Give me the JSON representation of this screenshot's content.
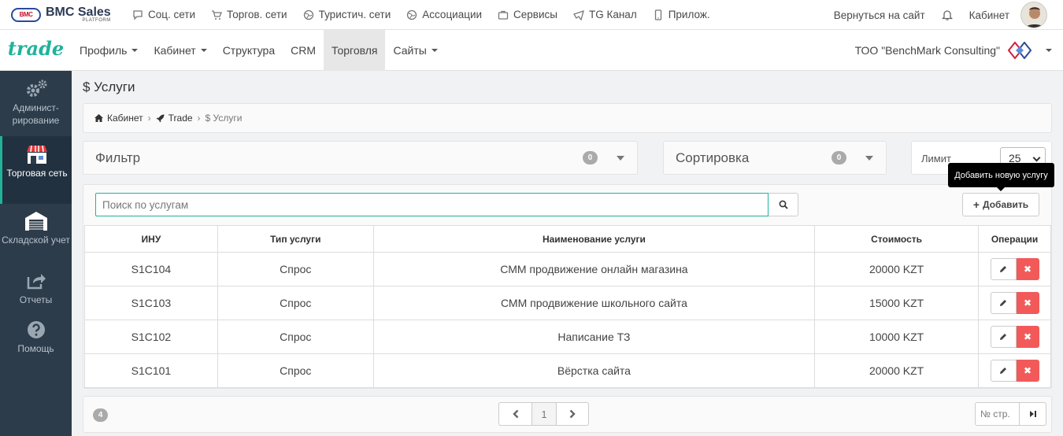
{
  "topbar": {
    "logo_badge": "BMC",
    "logo_title": "BMC Sales",
    "logo_sub": "PLATFORM",
    "links": [
      {
        "label": "Соц. сети",
        "icon": "chat-icon"
      },
      {
        "label": "Торгов. сети",
        "icon": "cart-icon"
      },
      {
        "label": "Туристич. сети",
        "icon": "globe-icon"
      },
      {
        "label": "Ассоциации",
        "icon": "globe-icon"
      },
      {
        "label": "Сервисы",
        "icon": "briefcase-icon"
      },
      {
        "label": "TG Канал",
        "icon": "telegram-icon"
      },
      {
        "label": "Прилож.",
        "icon": "mobile-icon"
      }
    ],
    "back_to_site": "Вернуться на сайт",
    "cabinet": "Кабинет"
  },
  "navbar": {
    "brand": "trade",
    "items": [
      {
        "label": "Профиль",
        "dropdown": true
      },
      {
        "label": "Кабинет",
        "dropdown": true
      },
      {
        "label": "Структура",
        "dropdown": false
      },
      {
        "label": "CRM",
        "dropdown": false
      },
      {
        "label": "Торговля",
        "dropdown": false,
        "active": true
      },
      {
        "label": "Сайты",
        "dropdown": true
      }
    ],
    "company": "ТОО \"BenchMark Consulting\""
  },
  "sidebar": {
    "items": [
      {
        "label": "Админист-рирование",
        "icon": "gears-icon"
      },
      {
        "label": "Торговая сеть",
        "icon": "store-icon",
        "active": true
      },
      {
        "label": "Складской учет",
        "icon": "warehouse-icon"
      },
      {
        "label": "Отчеты",
        "icon": "share-icon"
      },
      {
        "label": "Помощь",
        "icon": "help-icon"
      }
    ]
  },
  "page": {
    "title": "$ Услуги",
    "breadcrumb": {
      "home": "Кабинет",
      "trade": "Trade",
      "current": "$ Услуги"
    }
  },
  "filter": {
    "title": "Фильтр",
    "count": "0"
  },
  "sort": {
    "title": "Сортировка",
    "count": "0"
  },
  "limit": {
    "label": "Лимит",
    "value": "25"
  },
  "search": {
    "placeholder": "Поиск по услугам",
    "value": ""
  },
  "add_button": "Добавить",
  "tooltip": "Добавить новую услугу",
  "table": {
    "headers": [
      "ИНУ",
      "Тип услуги",
      "Наименование услуги",
      "Стоимость",
      "Операции"
    ],
    "rows": [
      [
        "S1C104",
        "Спрос",
        "СММ продвижение онлайн магазина",
        "20000 KZT"
      ],
      [
        "S1C103",
        "Спрос",
        "СММ продвижение школьного сайта",
        "15000 KZT"
      ],
      [
        "S1C102",
        "Спрос",
        "Написание ТЗ",
        "10000 KZT"
      ],
      [
        "S1C101",
        "Спрос",
        "Вёрстка сайта",
        "20000 KZT"
      ]
    ]
  },
  "footer": {
    "total": "4",
    "current_page": "1",
    "goto_placeholder": "№ стр."
  },
  "colors": {
    "accent": "#20b39a",
    "sidebar": "#2d3c4b",
    "danger": "#f25a5a"
  }
}
